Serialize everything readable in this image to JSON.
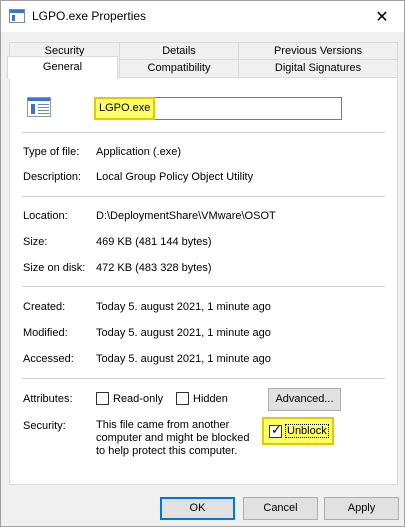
{
  "window": {
    "title": "LGPO.exe Properties"
  },
  "tabs_row1": [
    "Security",
    "Details",
    "Previous Versions"
  ],
  "tabs_row2": [
    "General",
    "Compatibility",
    "Digital Signatures"
  ],
  "general": {
    "file_name": "LGPO.exe",
    "type_label": "Type of file:",
    "type_value": "Application (.exe)",
    "description_label": "Description:",
    "description_value": "Local Group Policy Object Utility",
    "location_label": "Location:",
    "location_value": "D:\\DeploymentShare\\VMware\\OSOT",
    "size_label": "Size:",
    "size_value": "469 KB (481 144 bytes)",
    "size_on_disk_label": "Size on disk:",
    "size_on_disk_value": "472 KB (483 328 bytes)",
    "created_label": "Created:",
    "created_value": "Today 5. august 2021, 1 minute ago",
    "modified_label": "Modified:",
    "modified_value": "Today 5. august 2021, 1 minute ago",
    "accessed_label": "Accessed:",
    "accessed_value": "Today 5. august 2021, 1 minute ago",
    "attributes_label": "Attributes:",
    "readonly_label": "Read-only",
    "readonly_checked": false,
    "hidden_label": "Hidden",
    "hidden_checked": false,
    "advanced_label": "Advanced...",
    "security_label": "Security:",
    "security_text": "This file came from another computer and might be blocked to help protect this computer.",
    "unblock_label": "Unblock",
    "unblock_checked": true
  },
  "buttons": {
    "ok": "OK",
    "cancel": "Cancel",
    "apply": "Apply"
  },
  "colors": {
    "highlight": "#ffff66",
    "highlight_border": "#e4c800",
    "primary_border": "#0078d7"
  },
  "icons": {
    "title": "application-exe-icon",
    "close": "close-icon",
    "file": "application-exe-icon"
  }
}
